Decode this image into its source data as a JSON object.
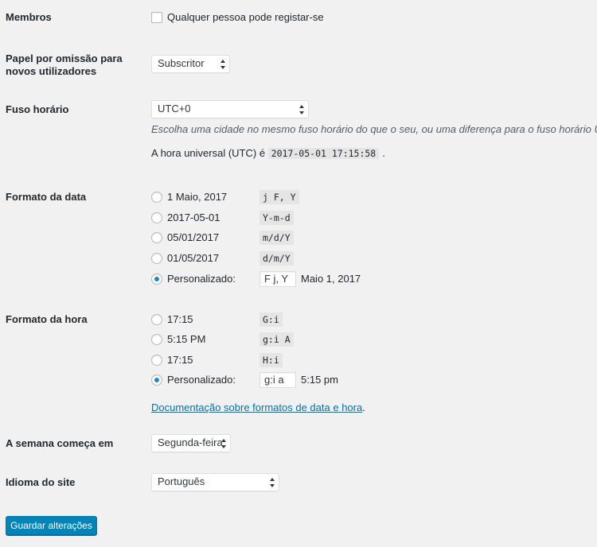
{
  "membership": {
    "label": "Membros",
    "checkbox_label": "Qualquer pessoa pode registar-se"
  },
  "default_role": {
    "label_line1": "Papel por omissão para",
    "label_line2": "novos utilizadores",
    "value": "Subscritor"
  },
  "timezone": {
    "label": "Fuso horário",
    "value": "UTC+0",
    "description": "Escolha uma cidade no mesmo fuso horário do que o seu, ou uma diferença para o fuso horário UTC.",
    "utc_prefix": "A hora universal (UTC) é",
    "utc_value": "2017-05-01 17:15:58",
    "utc_suffix": "."
  },
  "date_format": {
    "label": "Formato da data",
    "options": [
      {
        "display": "1 Maio, 2017",
        "code": "j F, Y",
        "checked": false
      },
      {
        "display": "2017-05-01",
        "code": "Y-m-d",
        "checked": false
      },
      {
        "display": "05/01/2017",
        "code": "m/d/Y",
        "checked": false
      },
      {
        "display": "01/05/2017",
        "code": "d/m/Y",
        "checked": false
      }
    ],
    "custom_label": "Personalizado:",
    "custom_value": "F j, Y",
    "custom_preview": "Maio 1, 2017"
  },
  "time_format": {
    "label": "Formato da hora",
    "options": [
      {
        "display": "17:15",
        "code": "G:i",
        "checked": false
      },
      {
        "display": "5:15 PM",
        "code": "g:i A",
        "checked": false
      },
      {
        "display": "17:15",
        "code": "H:i",
        "checked": false
      }
    ],
    "custom_label": "Personalizado:",
    "custom_value": "g:i a",
    "custom_preview": "5:15 pm",
    "doc_link": "Documentação sobre formatos de data e hora",
    "doc_suffix": "."
  },
  "week_start": {
    "label": "A semana começa em",
    "value": "Segunda-feira"
  },
  "site_language": {
    "label": "Idioma do site",
    "value": "Português"
  },
  "save_button": "Guardar alterações",
  "colors": {
    "accent": "#0085ba",
    "link": "#0073aa",
    "radio_dot": "#1e8cbe",
    "background": "#f1f1f1"
  }
}
